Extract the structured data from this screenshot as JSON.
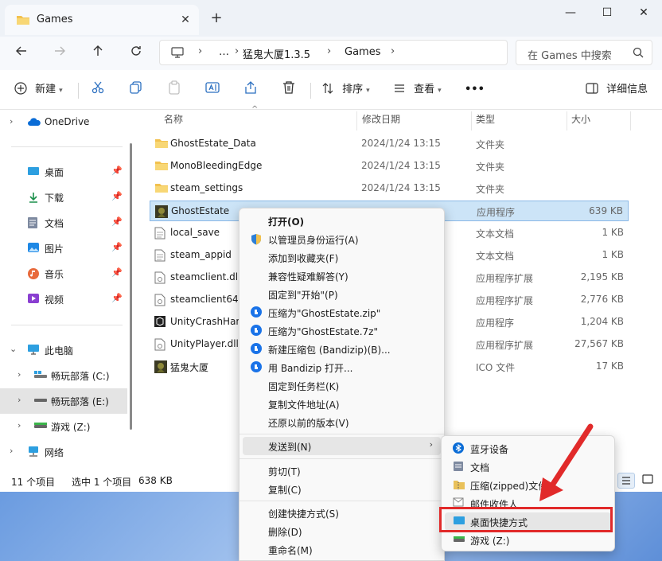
{
  "window": {
    "tab_title": "Games",
    "new_tab": "+",
    "tab_close": "✕",
    "minimize": "—",
    "maximize": "☐",
    "close": "✕"
  },
  "address": {
    "more": "…",
    "crumbs": [
      "猛鬼大厦1.3.5",
      "Games"
    ],
    "sep": "›",
    "search_placeholder": "在 Games 中搜索"
  },
  "toolbar": {
    "new_label": "新建",
    "sort_label": "排序",
    "view_label": "查看",
    "more_label": "•••",
    "details_label": "详细信息"
  },
  "nav": {
    "items": [
      {
        "label": "OneDrive",
        "icon": "cloud-icon"
      },
      {
        "label": "桌面",
        "icon": "desktop-icon"
      },
      {
        "label": "下载",
        "icon": "download-icon"
      },
      {
        "label": "文档",
        "icon": "document-icon"
      },
      {
        "label": "图片",
        "icon": "pictures-icon"
      },
      {
        "label": "音乐",
        "icon": "music-icon"
      },
      {
        "label": "视频",
        "icon": "video-icon"
      },
      {
        "label": "此电脑",
        "icon": "pc-icon"
      },
      {
        "label": "畅玩部落 (C:)",
        "icon": "drive-icon"
      },
      {
        "label": "畅玩部落 (E:)",
        "icon": "drive-icon"
      },
      {
        "label": "游戏 (Z:)",
        "icon": "drive-icon"
      },
      {
        "label": "网络",
        "icon": "network-icon"
      }
    ]
  },
  "columns": {
    "name": "名称",
    "date": "修改日期",
    "type": "类型",
    "size": "大小"
  },
  "files": [
    {
      "name": "GhostEstate_Data",
      "date": "2024/1/24 13:15",
      "type": "文件夹",
      "size": "",
      "icon": "folder-icon"
    },
    {
      "name": "MonoBleedingEdge",
      "date": "2024/1/24 13:15",
      "type": "文件夹",
      "size": "",
      "icon": "folder-icon"
    },
    {
      "name": "steam_settings",
      "date": "2024/1/24 13:15",
      "type": "文件夹",
      "size": "",
      "icon": "folder-icon"
    },
    {
      "name": "GhostEstate",
      "date": "",
      "type": "应用程序",
      "size": "639 KB",
      "icon": "game-app-icon"
    },
    {
      "name": "local_save",
      "date": "",
      "type": "文本文档",
      "size": "1 KB",
      "icon": "text-file-icon"
    },
    {
      "name": "steam_appid",
      "date": "",
      "type": "文本文档",
      "size": "1 KB",
      "icon": "text-file-icon"
    },
    {
      "name": "steamclient.dll",
      "date": "",
      "type": "应用程序扩展",
      "size": "2,195 KB",
      "icon": "dll-file-icon"
    },
    {
      "name": "steamclient64.d",
      "date": "",
      "type": "应用程序扩展",
      "size": "2,776 KB",
      "icon": "dll-file-icon"
    },
    {
      "name": "UnityCrashHan",
      "date": "",
      "type": "应用程序",
      "size": "1,204 KB",
      "icon": "unity-app-icon"
    },
    {
      "name": "UnityPlayer.dll",
      "date": "",
      "type": "应用程序扩展",
      "size": "27,567 KB",
      "icon": "dll-file-icon"
    },
    {
      "name": "猛鬼大厦",
      "date": "",
      "type": "ICO 文件",
      "size": "17 KB",
      "icon": "game-ico-icon"
    }
  ],
  "status": {
    "count": "11 个项目",
    "selected": "选中 1 个项目",
    "size": "638 KB"
  },
  "context_menu": {
    "items": [
      {
        "label": "打开(O)",
        "icon": ""
      },
      {
        "label": "以管理员身份运行(A)",
        "icon": "shield-icon"
      },
      {
        "label": "添加到收藏夹(F)",
        "icon": ""
      },
      {
        "label": "兼容性疑难解答(Y)",
        "icon": ""
      },
      {
        "label": "固定到\"开始\"(P)",
        "icon": ""
      },
      {
        "label": "压缩为\"GhostEstate.zip\"",
        "icon": "bandizip-icon"
      },
      {
        "label": "压缩为\"GhostEstate.7z\"",
        "icon": "bandizip-icon"
      },
      {
        "label": "新建压缩包 (Bandizip)(B)...",
        "icon": "bandizip-icon"
      },
      {
        "label": "用 Bandizip 打开...",
        "icon": "bandizip-icon"
      },
      {
        "label": "固定到任务栏(K)",
        "icon": ""
      },
      {
        "label": "复制文件地址(A)",
        "icon": ""
      },
      {
        "label": "还原以前的版本(V)",
        "icon": ""
      },
      {
        "label": "发送到(N)",
        "icon": ""
      },
      {
        "label": "剪切(T)",
        "icon": ""
      },
      {
        "label": "复制(C)",
        "icon": ""
      },
      {
        "label": "创建快捷方式(S)",
        "icon": ""
      },
      {
        "label": "删除(D)",
        "icon": ""
      },
      {
        "label": "重命名(M)",
        "icon": ""
      }
    ],
    "submenu_arrow": "›"
  },
  "send_to_menu": {
    "items": [
      {
        "label": "蓝牙设备",
        "icon": "bluetooth-icon"
      },
      {
        "label": "文档",
        "icon": "document-icon"
      },
      {
        "label": "压缩(zipped)文件",
        "icon": "zip-folder-icon"
      },
      {
        "label": "邮件收件人",
        "icon": "mail-icon"
      },
      {
        "label": "桌面快捷方式",
        "icon": "desktop-icon"
      },
      {
        "label": "游戏 (Z:)",
        "icon": "drive-icon"
      }
    ]
  },
  "colors": {
    "accent": "#0067c0",
    "selection": "#cce4f7",
    "annotation": "#e12a2a"
  }
}
